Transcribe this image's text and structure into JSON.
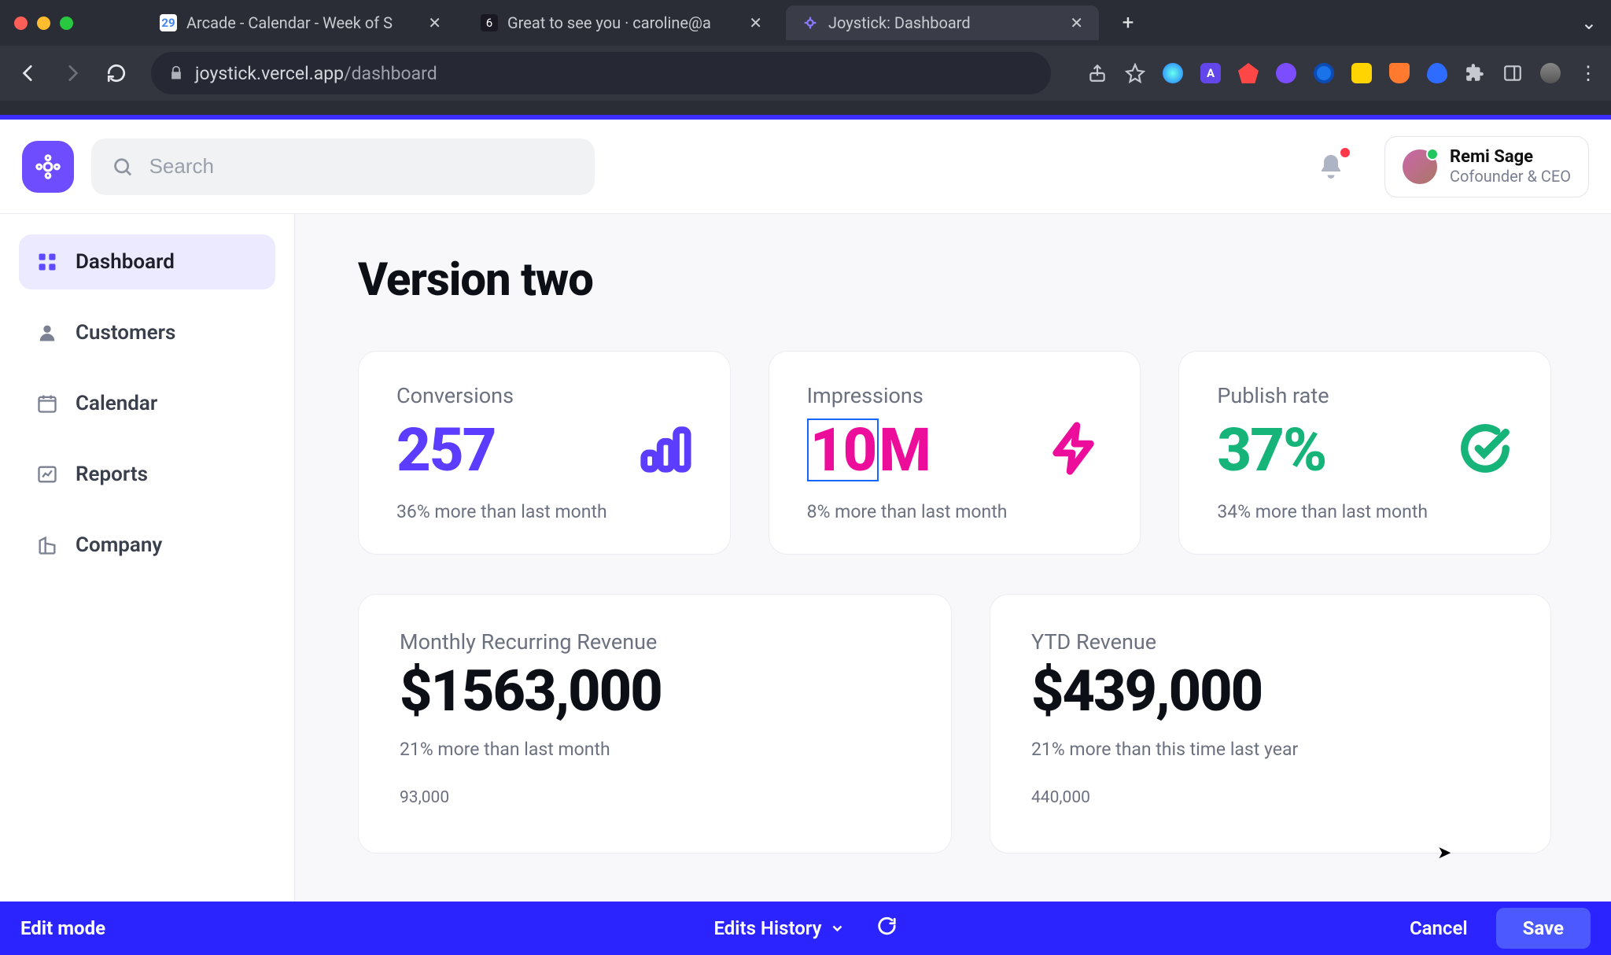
{
  "browser": {
    "tabs": [
      {
        "title": "Arcade - Calendar - Week of S",
        "active": false
      },
      {
        "title": "Great to see you · caroline@a",
        "active": false
      },
      {
        "title": "Joystick: Dashboard",
        "active": true
      }
    ],
    "url_host": "joystick.vercel.app",
    "url_path": "/dashboard"
  },
  "app": {
    "search_placeholder": "Search",
    "user": {
      "name": "Remi Sage",
      "role": "Cofounder & CEO"
    },
    "sidebar": [
      {
        "label": "Dashboard",
        "active": true
      },
      {
        "label": "Customers",
        "active": false
      },
      {
        "label": "Calendar",
        "active": false
      },
      {
        "label": "Reports",
        "active": false
      },
      {
        "label": "Company",
        "active": false
      }
    ],
    "page_title": "Version two",
    "stats": [
      {
        "label": "Conversions",
        "value": "257",
        "sub": "36% more than last month",
        "color": "purple",
        "icon": "bar"
      },
      {
        "label": "Impressions",
        "value_boxed": "10",
        "value_tail": "M",
        "sub": "8% more than last month",
        "color": "pink",
        "icon": "lightning"
      },
      {
        "label": "Publish rate",
        "value": "37%",
        "sub": "34% more than last month",
        "color": "green",
        "icon": "check"
      }
    ],
    "rev": [
      {
        "label": "Monthly Recurring Revenue",
        "value": "$1563,000",
        "sub": "21% more than last month",
        "tick": "93,000"
      },
      {
        "label": "YTD Revenue",
        "value": "$439,000",
        "sub": "21% more than this time last year",
        "tick": "440,000"
      }
    ],
    "edit_bar": {
      "mode": "Edit mode",
      "history": "Edits History",
      "cancel": "Cancel",
      "save": "Save"
    }
  },
  "chart_data": [
    {
      "type": "line",
      "title": "Monthly Recurring Revenue",
      "ylim_top": 93000
    },
    {
      "type": "line",
      "title": "YTD Revenue",
      "ylim_top": 440000
    }
  ]
}
